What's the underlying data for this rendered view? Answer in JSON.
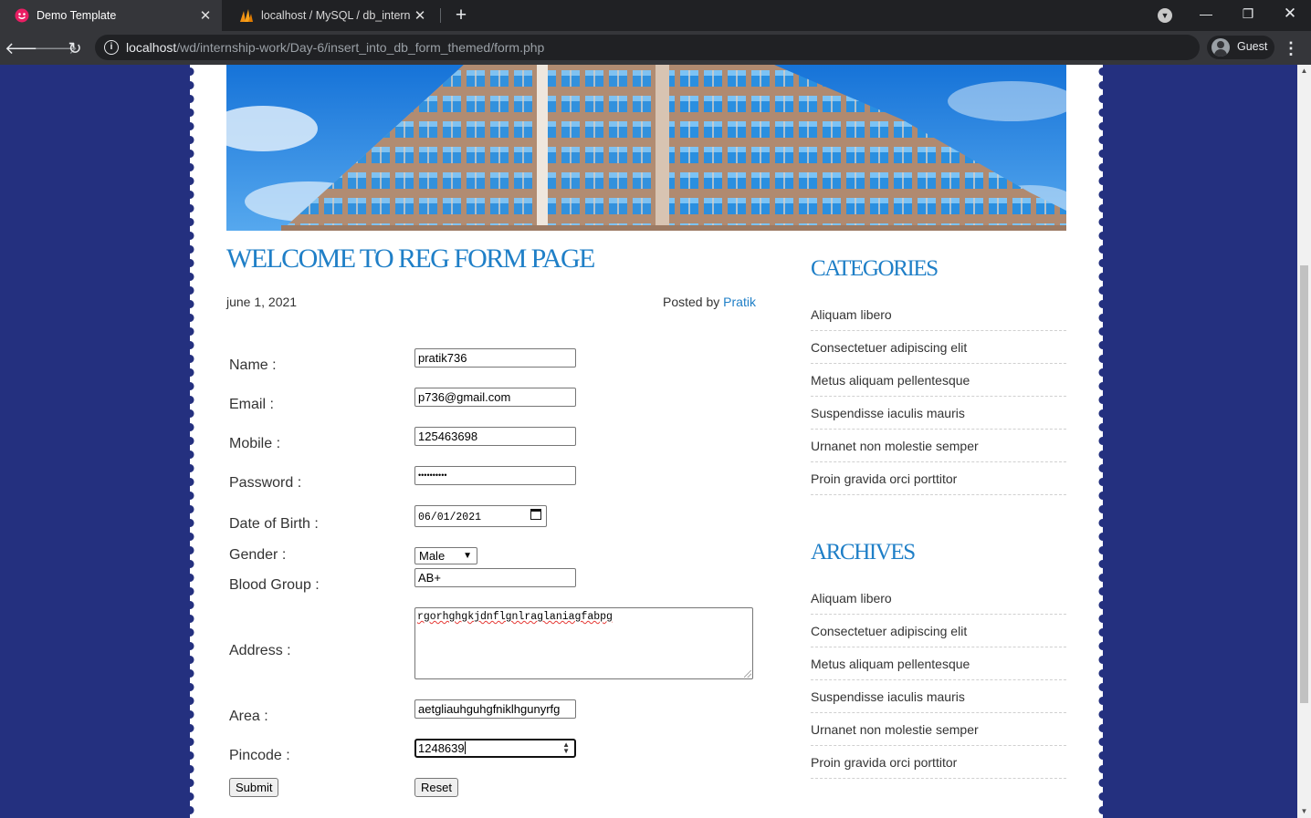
{
  "browser": {
    "tabs": [
      {
        "title": "Demo Template",
        "active": true
      },
      {
        "title": "localhost / MySQL / db_internship",
        "active": false
      }
    ],
    "url_host": "localhost",
    "url_path": "/wd/internship-work/Day-6/insert_into_db_form_themed/form.php",
    "profile": "Guest"
  },
  "post": {
    "title": "WELCOME TO REG FORM PAGE",
    "date": "june 1, 2021",
    "posted_by_label": "Posted by",
    "author": "Pratik"
  },
  "form": {
    "name_label": "Name :",
    "name_value": "pratik736",
    "email_label": "Email :",
    "email_value": "p736@gmail.com",
    "mobile_label": "Mobile :",
    "mobile_value": "125463698",
    "password_label": "Password :",
    "password_value": "••••••••••",
    "dob_label": "Date of Birth :",
    "dob_value": "06/01/2021",
    "gender_label": "Gender :",
    "gender_value": "Male",
    "blood_label": "Blood Group :",
    "blood_value": "AB+",
    "address_label": "Address :",
    "address_value": "rgorhghgkjdnflgnlraglaniagfabpg",
    "area_label": "Area :",
    "area_value": "aetgliauhguhgfniklhgunyrfg",
    "pincode_label": "Pincode :",
    "pincode_value": "1248639",
    "submit_label": "Submit",
    "reset_label": "Reset"
  },
  "sidebar": {
    "categories_title": "CATEGORIES",
    "categories": [
      "Aliquam libero",
      "Consectetuer adipiscing elit",
      "Metus aliquam pellentesque",
      "Suspendisse iaculis mauris",
      "Urnanet non molestie semper",
      "Proin gravida orci porttitor"
    ],
    "archives_title": "ARCHIVES",
    "archives": [
      "Aliquam libero",
      "Consectetuer adipiscing elit",
      "Metus aliquam pellentesque",
      "Suspendisse iaculis mauris",
      "Urnanet non molestie semper",
      "Proin gravida orci porttitor"
    ]
  },
  "colors": {
    "page_background": "#24307f",
    "heading_blue": "#1f7fc7",
    "browser_dark": "#202124"
  }
}
